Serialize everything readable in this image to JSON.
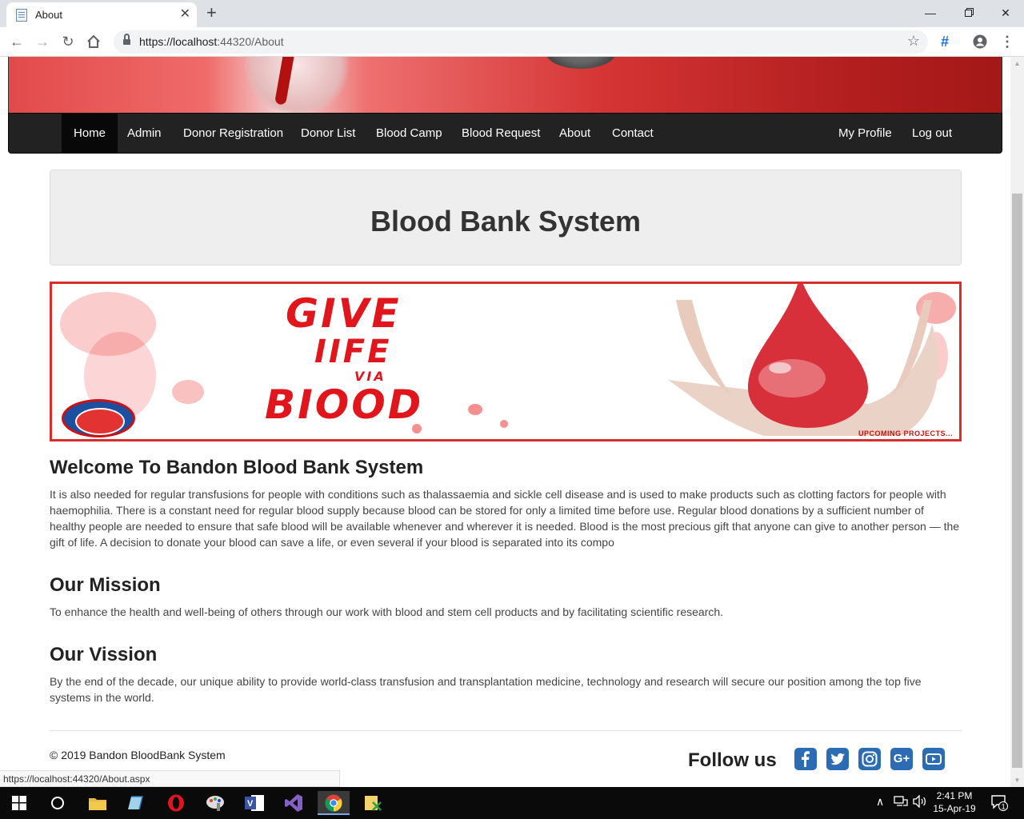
{
  "browser": {
    "tab_title": "About",
    "url_host": "https://localhost",
    "url_rest": ":44320/About",
    "status_url": "https://localhost:44320/About.aspx"
  },
  "navbar": {
    "items": [
      "Home",
      "Admin",
      "Donor Registration",
      "Donor List",
      "Blood Camp",
      "Blood Request",
      "About",
      "Contact"
    ],
    "right_items": [
      "My Profile",
      "Log out"
    ],
    "active": "Home"
  },
  "jumbotron": {
    "title": "Blood Bank System"
  },
  "banner": {
    "line1": "GIVE",
    "line2": "IIFE",
    "line3": "VIA",
    "line4": "BIOOD",
    "footer": "UPCOMING PROJECTS..."
  },
  "welcome": {
    "heading": "Welcome To Bandon Blood Bank System",
    "text": "It is also needed for regular transfusions for people with conditions such as thalassaemia and sickle cell disease and is used to make products such as clotting factors for people with haemophilia. There is a constant need for regular blood supply because blood can be stored for only a limited time before use. Regular blood donations by a sufficient number of healthy people are needed to ensure that safe blood will be available whenever and wherever it is needed. Blood is the most precious gift that anyone can give to another person — the gift of life. A decision to donate your blood can save a life, or even several if your blood is separated into its compo"
  },
  "mission": {
    "heading": "Our Mission",
    "text": "To enhance the health and well-being of others through our work with blood and stem cell products and by facilitating scientific research."
  },
  "vision": {
    "heading": "Our Vission",
    "text": "By the end of the decade, our unique ability to provide world-class transfusion and transplantation medicine, technology and research will secure our position among the top five systems in the world."
  },
  "footer": {
    "copyright": "© 2019 Bandon BloodBank System",
    "follow": "Follow us",
    "social_icons": [
      "facebook-icon",
      "twitter-icon",
      "instagram-icon",
      "google-plus-icon",
      "youtube-icon"
    ],
    "google_plus_label": "G+",
    "social_color": "#2b6cb5"
  },
  "taskbar": {
    "time": "2:41 PM",
    "date": "15-Apr-19",
    "notification_count": "1"
  }
}
